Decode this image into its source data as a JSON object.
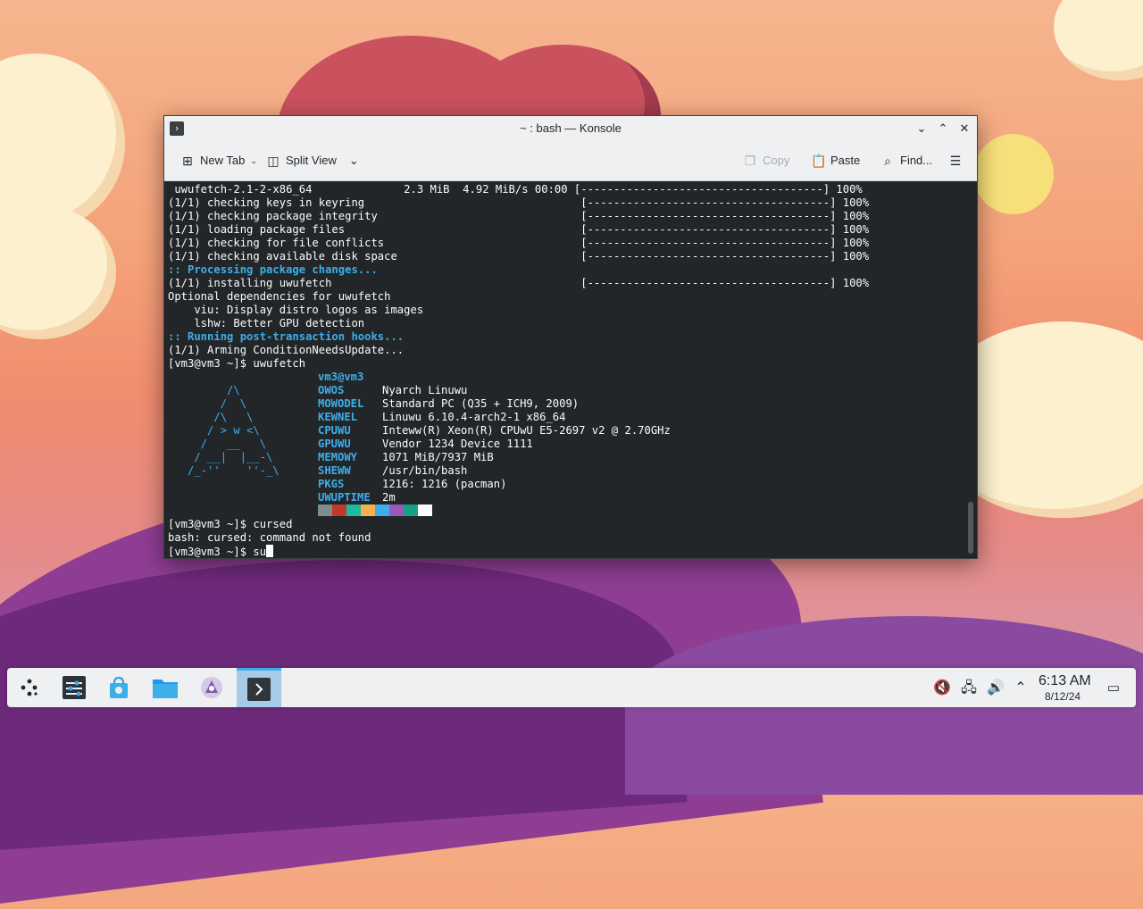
{
  "window": {
    "title": "~ : bash — Konsole",
    "controls": {
      "minimize": "⌄",
      "maximize": "⌃",
      "close": "✕"
    }
  },
  "toolbar": {
    "new_tab": "New Tab",
    "split_view": "Split View",
    "copy": "Copy",
    "paste": "Paste",
    "find": "Find...",
    "menu_icon": "hamburger-menu-icon"
  },
  "terminal": {
    "lines": [
      " uwufetch-2.1-2-x86_64              2.3 MiB  4.92 MiB/s 00:00 [-------------------------------------] 100%",
      "(1/1) checking keys in keyring                                 [-------------------------------------] 100%",
      "(1/1) checking package integrity                               [-------------------------------------] 100%",
      "(1/1) loading package files                                    [-------------------------------------] 100%",
      "(1/1) checking for file conflicts                              [-------------------------------------] 100%",
      "(1/1) checking available disk space                            [-------------------------------------] 100%",
      ":: Processing package changes...",
      "(1/1) installing uwufetch                                      [-------------------------------------] 100%",
      "Optional dependencies for uwufetch",
      "    viu: Display distro logos as images",
      "    lshw: Better GPU detection",
      ":: Running post-transaction hooks...",
      "(1/1) Arming ConditionNeedsUpdate...",
      "[vm3@vm3 ~]$ uwufetch"
    ],
    "highlighted_lines": [
      6,
      11
    ],
    "logo": [
      "         /\\",
      "        /  \\",
      "       /\\   \\",
      "      / > w <\\",
      "     /   __   \\",
      "    / __|  |__-\\",
      "   /_-''    ''-_\\"
    ],
    "user_host": "vm3@vm3",
    "info": [
      {
        "key": "OWOS",
        "value": "Nyarch Linuwu"
      },
      {
        "key": "MOWODEL",
        "value": "Standard PC (Q35 + ICH9, 2009)"
      },
      {
        "key": "KEWNEL",
        "value": "Linuwu 6.10.4-arch2-1 x86_64"
      },
      {
        "key": "CPUWU",
        "value": "Inteww(R) Xeon(R) CPUwU E5-2697 v2 @ 2.70GHz"
      },
      {
        "key": "GPUWU",
        "value": "Vendor 1234 Device 1111"
      },
      {
        "key": "MEMOWY",
        "value": "1071 MiB/7937 MiB"
      },
      {
        "key": "SHEWW",
        "value": "/usr/bin/bash"
      },
      {
        "key": "PKGS",
        "value": "1216: 1216 (pacman)"
      },
      {
        "key": "UWUPTIME",
        "value": "2m"
      }
    ],
    "palette": [
      "#7f8c8d",
      "#c0392b",
      "#1abc9c",
      "#f4b350",
      "#3daee9",
      "#9b59b6",
      "#16a085",
      "#fcfcfc"
    ],
    "after": [
      "[vm3@vm3 ~]$ cursed",
      "bash: cursed: command not found"
    ],
    "prompt": "[vm3@vm3 ~]$ ",
    "input": "su"
  },
  "taskbar": {
    "launchers": [
      {
        "name": "application-launcher",
        "icon": "kde-launcher-icon"
      },
      {
        "name": "system-settings",
        "icon": "settings-sliders-icon"
      },
      {
        "name": "discover",
        "icon": "store-bag-icon"
      },
      {
        "name": "dolphin",
        "icon": "folder-icon"
      },
      {
        "name": "nyarch-app",
        "icon": "nyarch-logo-icon"
      },
      {
        "name": "konsole",
        "icon": "terminal-icon",
        "active": true
      }
    ],
    "tray": [
      "mute-icon",
      "network-icon",
      "volume-icon",
      "expand-tray-icon"
    ],
    "clock": {
      "time": "6:13 AM",
      "date": "8/12/24"
    },
    "show_desktop": "show-desktop-icon"
  }
}
